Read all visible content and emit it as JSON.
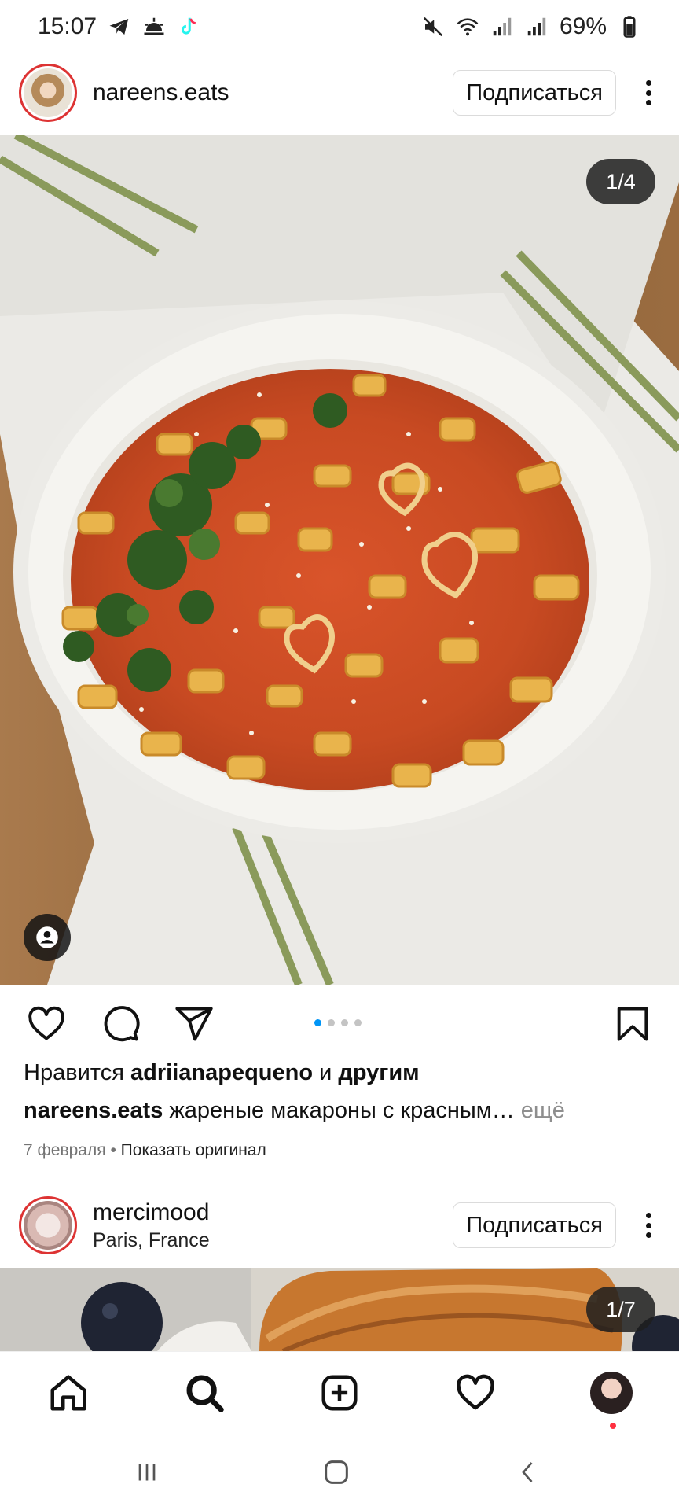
{
  "status_bar": {
    "time": "15:07",
    "battery": "69%",
    "left_icons": [
      "telegram-icon",
      "weather-icon",
      "tiktok-icon"
    ],
    "right_icons": [
      "mute-icon",
      "wifi-icon",
      "signal-icon",
      "signal-icon",
      "battery-icon"
    ]
  },
  "post1": {
    "username": "nareens.eats",
    "follow_label": "Подписаться",
    "counter": "1/4",
    "dots": {
      "total": 4,
      "active": 1
    },
    "likes_prefix": "Нравится",
    "likes_user": "adriianapequeno",
    "likes_and": "и",
    "likes_others": "другим",
    "caption_user": "nareens.eats",
    "caption_text": "жареные макароны с красным…",
    "caption_more": "ещё",
    "date": "7 февраля",
    "separator": "•",
    "translate_link": "Показать оригинал"
  },
  "post2": {
    "username": "mercimood",
    "location": "Paris, France",
    "follow_label": "Подписаться",
    "counter": "1/7"
  },
  "bottom_nav": [
    "home-icon",
    "search-icon",
    "create-icon",
    "heart-icon",
    "profile-avatar"
  ],
  "system_nav": [
    "recents-icon",
    "home-icon",
    "back-icon"
  ],
  "colors": {
    "accent_blue": "#0095f6",
    "notification_red": "#ff3040",
    "avatar_ring": "#d33"
  }
}
